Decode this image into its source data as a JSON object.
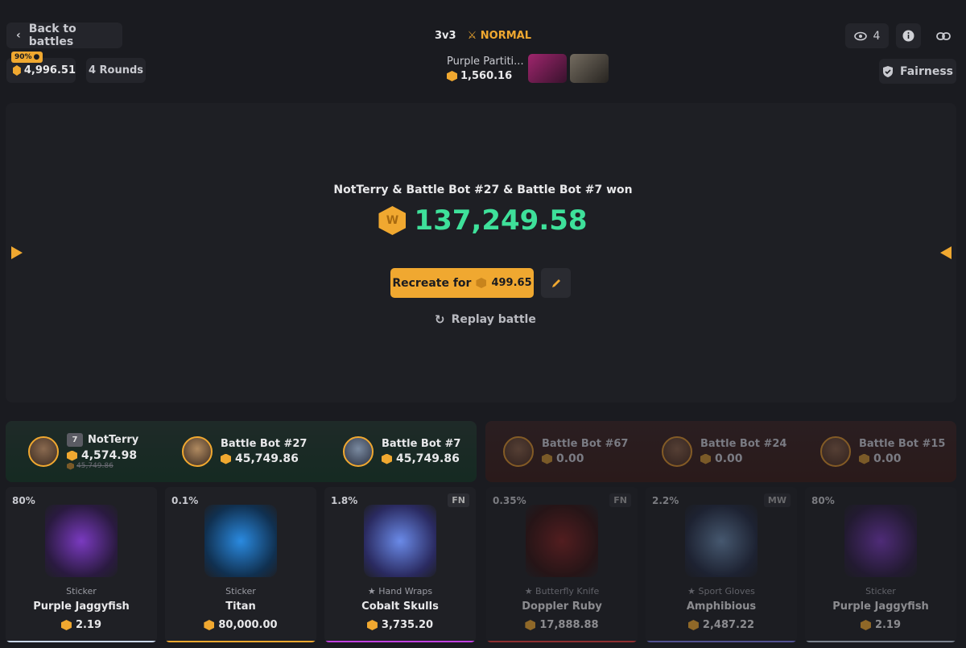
{
  "header": {
    "back_label": "Back to battles",
    "balance": "4,996.51",
    "discount_badge": "90%",
    "rounds": "4 Rounds",
    "mode_size": "3v3",
    "mode_name": "NORMAL",
    "case_name": "Purple Partiti...",
    "case_price": "1,560.16",
    "viewers": "4",
    "fairness_label": "Fairness"
  },
  "result": {
    "winner_text": "NotTerry & Battle Bot #27 & Battle Bot #7 won",
    "total": "137,249.58",
    "coin_letter": "W",
    "recreate_label": "Recreate for",
    "recreate_price": "499.65",
    "replay_label": "Replay battle"
  },
  "team_a": [
    {
      "name": "NotTerry",
      "level": "7",
      "value": "4,574.98",
      "old_value": "45,749.86"
    },
    {
      "name": "Battle Bot #27",
      "value": "45,749.86"
    },
    {
      "name": "Battle Bot #7",
      "value": "45,749.86"
    }
  ],
  "team_b": [
    {
      "name": "Battle Bot #67",
      "value": "0.00"
    },
    {
      "name": "Battle Bot #24",
      "value": "0.00"
    },
    {
      "name": "Battle Bot #15",
      "value": "0.00"
    }
  ],
  "items": [
    {
      "chance": "80%",
      "wear": "",
      "type": "Sticker",
      "name": "Purple Jaggyfish",
      "price": "2.19",
      "color": "#c9d6e8"
    },
    {
      "chance": "0.1%",
      "wear": "",
      "type": "Sticker",
      "name": "Titan",
      "price": "80,000.00",
      "color": "#f0a830"
    },
    {
      "chance": "1.8%",
      "wear": "FN",
      "type": "★ Hand Wraps",
      "name": "Cobalt Skulls",
      "price": "3,735.20",
      "color": "#c040e0"
    },
    {
      "chance": "0.35%",
      "wear": "FN",
      "type": "★ Butterfly Knife",
      "name": "Doppler Ruby",
      "price": "17,888.88",
      "color": "#f04040"
    },
    {
      "chance": "2.2%",
      "wear": "MW",
      "type": "★ Sport Gloves",
      "name": "Amphibious",
      "price": "2,487.22",
      "color": "#8080f0"
    },
    {
      "chance": "80%",
      "wear": "",
      "type": "Sticker",
      "name": "Purple Jaggyfish",
      "price": "2.19",
      "color": "#c9d6e8"
    }
  ]
}
